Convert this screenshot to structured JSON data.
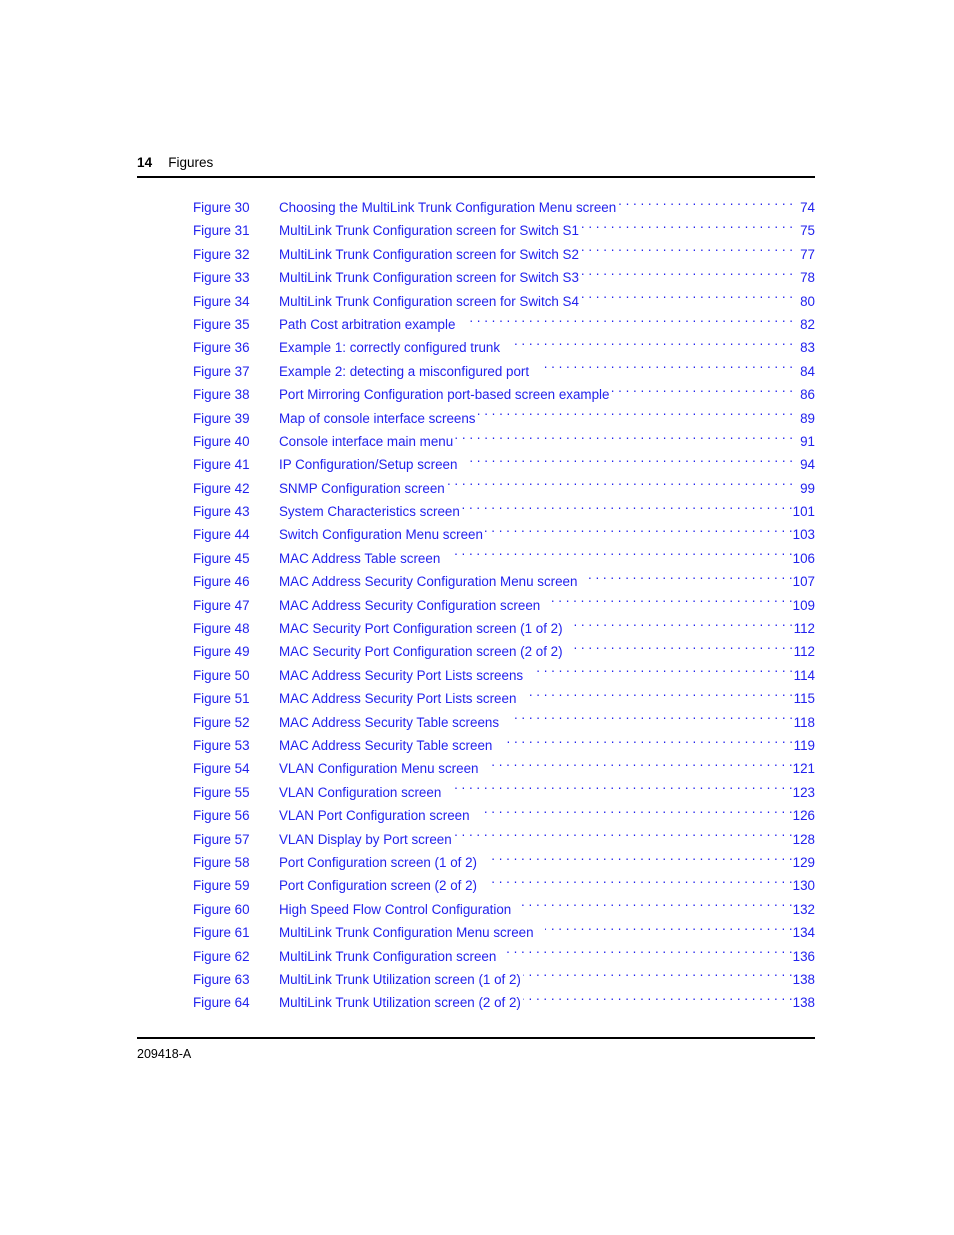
{
  "header": {
    "folio": "14",
    "title": "Figures"
  },
  "footer": {
    "document_number": "209418-A"
  },
  "colors": {
    "link": "#2222ee",
    "text": "#000000",
    "background": "#ffffff"
  },
  "toc": {
    "entries": [
      {
        "label": "Figure 30",
        "title": "Choosing the MultiLink Trunk Configuration Menu screen",
        "page": "74",
        "gap": false
      },
      {
        "label": "Figure 31",
        "title": "MultiLink Trunk Configuration screen for Switch S1",
        "page": "75",
        "gap": false
      },
      {
        "label": "Figure 32",
        "title": "MultiLink Trunk Configuration screen for Switch S2",
        "page": "77",
        "gap": false
      },
      {
        "label": "Figure 33",
        "title": "MultiLink Trunk Configuration screen for Switch S3",
        "page": "78",
        "gap": false
      },
      {
        "label": "Figure 34",
        "title": "MultiLink Trunk Configuration screen for Switch S4",
        "page": "80",
        "gap": false
      },
      {
        "label": "Figure 35",
        "title": "Path Cost arbitration example",
        "page": "82",
        "gap": true
      },
      {
        "label": "Figure 36",
        "title": "Example 1: correctly configured trunk",
        "page": "83",
        "gap": true
      },
      {
        "label": "Figure 37",
        "title": "Example 2: detecting a misconfigured port",
        "page": "84",
        "gap": true
      },
      {
        "label": "Figure 38",
        "title": "Port Mirroring Configuration port-based screen example",
        "page": "86",
        "gap": false
      },
      {
        "label": "Figure 39",
        "title": "Map of console interface screens",
        "page": "89",
        "gap": false
      },
      {
        "label": "Figure 40",
        "title": "Console interface main menu",
        "page": "91",
        "gap": false
      },
      {
        "label": "Figure 41",
        "title": "IP Configuration/Setup screen",
        "page": "94",
        "gap": true
      },
      {
        "label": "Figure 42",
        "title": "SNMP Configuration screen",
        "page": "99",
        "gap": false
      },
      {
        "label": "Figure 43",
        "title": "System Characteristics screen",
        "page": "101",
        "gap": false
      },
      {
        "label": "Figure 44",
        "title": "Switch Configuration Menu screen",
        "page": "103",
        "gap": false
      },
      {
        "label": "Figure 45",
        "title": "MAC Address Table screen",
        "page": "106",
        "gap": true
      },
      {
        "label": "Figure 46",
        "title": "MAC Address Security Configuration Menu screen",
        "page": "107",
        "gap": true
      },
      {
        "label": "Figure 47",
        "title": "MAC Address Security Configuration screen",
        "page": "109",
        "gap": true
      },
      {
        "label": "Figure 48",
        "title": "MAC Security Port Configuration screen (1 of 2)",
        "page": "112",
        "gap": true
      },
      {
        "label": "Figure 49",
        "title": "MAC Security Port Configuration screen (2 of 2)",
        "page": "112",
        "gap": true
      },
      {
        "label": "Figure 50",
        "title": "MAC Address Security Port Lists screens",
        "page": "114",
        "gap": true
      },
      {
        "label": "Figure 51",
        "title": "MAC Address Security Port Lists screen",
        "page": "115",
        "gap": true
      },
      {
        "label": "Figure 52",
        "title": "MAC Address Security Table screens",
        "page": "118",
        "gap": true
      },
      {
        "label": "Figure 53",
        "title": "MAC Address Security Table screen",
        "page": "119",
        "gap": true
      },
      {
        "label": "Figure 54",
        "title": "VLAN Configuration Menu screen",
        "page": "121",
        "gap": true
      },
      {
        "label": "Figure 55",
        "title": "VLAN Configuration screen",
        "page": "123",
        "gap": true
      },
      {
        "label": "Figure 56",
        "title": "VLAN Port Configuration screen",
        "page": "126",
        "gap": true
      },
      {
        "label": "Figure 57",
        "title": "VLAN Display by Port screen",
        "page": "128",
        "gap": false
      },
      {
        "label": "Figure 58",
        "title": "Port Configuration screen (1 of 2)",
        "page": "129",
        "gap": true
      },
      {
        "label": "Figure 59",
        "title": "Port Configuration screen (2 of 2)",
        "page": "130",
        "gap": true
      },
      {
        "label": "Figure 60",
        "title": "High Speed Flow Control Configuration",
        "page": "132",
        "gap": true
      },
      {
        "label": "Figure 61",
        "title": "MultiLink Trunk Configuration Menu screen",
        "page": "134",
        "gap": true
      },
      {
        "label": "Figure 62",
        "title": "MultiLink Trunk Configuration screen",
        "page": "136",
        "gap": true
      },
      {
        "label": "Figure 63",
        "title": "MultiLink Trunk Utilization screen (1 of 2)",
        "page": "138",
        "gap": false
      },
      {
        "label": "Figure 64",
        "title": "MultiLink Trunk Utilization screen (2 of 2)",
        "page": "138",
        "gap": false
      }
    ]
  }
}
